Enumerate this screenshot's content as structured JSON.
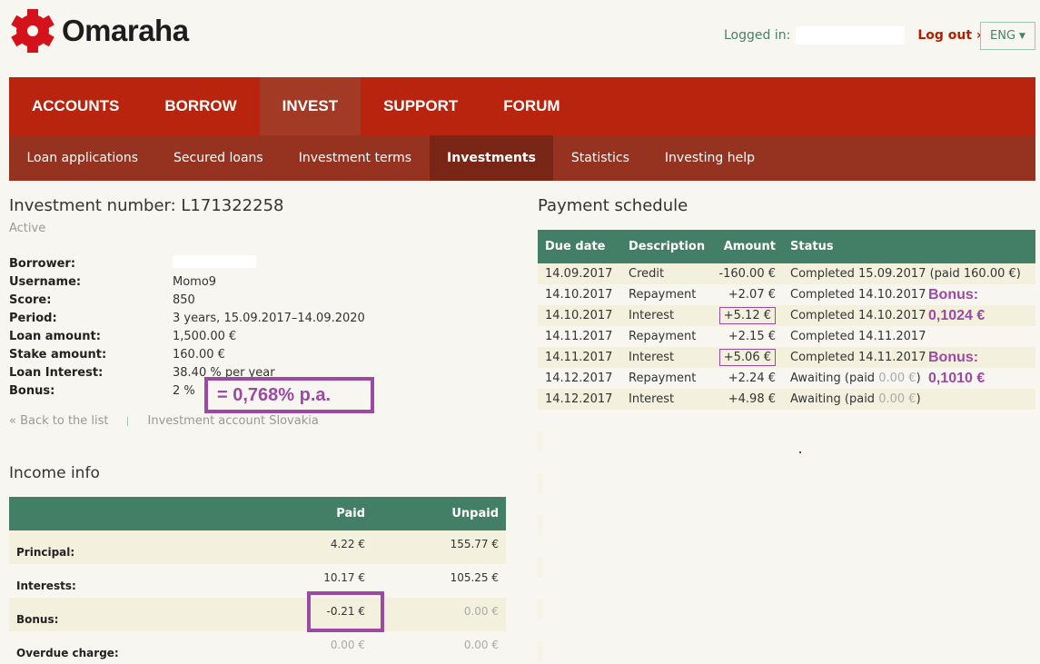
{
  "brand": {
    "name": "Omaraha",
    "logo_color": "#d3121c"
  },
  "header": {
    "logged_in_label": "Logged in:",
    "logout_label": "Log out »",
    "language": "ENG"
  },
  "main_nav": {
    "items": [
      {
        "label": "ACCOUNTS"
      },
      {
        "label": "BORROW"
      },
      {
        "label": "INVEST",
        "active": true
      },
      {
        "label": "SUPPORT"
      },
      {
        "label": "FORUM"
      }
    ]
  },
  "sub_nav": {
    "items": [
      {
        "label": "Loan applications"
      },
      {
        "label": "Secured loans"
      },
      {
        "label": "Investment terms"
      },
      {
        "label": "Investments",
        "active": true
      },
      {
        "label": "Statistics"
      },
      {
        "label": "Investing help"
      }
    ]
  },
  "investment": {
    "title": "Investment number: L171322258",
    "status": "Active",
    "details": [
      {
        "label": "Borrower:",
        "value": ""
      },
      {
        "label": "Username:",
        "value": "Momo9"
      },
      {
        "label": "Score:",
        "value": "850"
      },
      {
        "label": "Period:",
        "value": "3 years, 15.09.2017–14.09.2020"
      },
      {
        "label": "Loan amount:",
        "value": "1,500.00 €"
      },
      {
        "label": "Stake amount:",
        "value": "160.00 €"
      },
      {
        "label": "Loan Interest:",
        "value": "38.40 % per year"
      },
      {
        "label": "Bonus:",
        "value": "2 %"
      }
    ],
    "annotation_pa": "= 0,768% p.a.",
    "back_link": "« Back to the list",
    "account_link": "Investment account Slovakia"
  },
  "income_info": {
    "title": "Income info",
    "headers": [
      "",
      "Paid",
      "Unpaid"
    ],
    "rows": [
      {
        "label": "Principal:",
        "paid": "4.22 €",
        "unpaid": "155.77 €"
      },
      {
        "label": "Interests:",
        "paid": "10.17 €",
        "unpaid": "105.25 €"
      },
      {
        "label": "Bonus:",
        "paid": "-0.21 €",
        "unpaid": "0.00 €"
      },
      {
        "label": "Overdue charge:",
        "paid": "0.00 €",
        "unpaid": "0.00 €"
      }
    ]
  },
  "payment_schedule": {
    "title": "Payment schedule",
    "headers": [
      "Due date",
      "Description",
      "Amount",
      "Status"
    ],
    "rows": [
      {
        "date": "14.09.2017",
        "desc": "Credit",
        "amount": "-160.00 €",
        "status": "Completed 15.09.2017 (paid 160.00 €)"
      },
      {
        "date": "14.10.2017",
        "desc": "Repayment",
        "amount": "+2.07 €",
        "status": "Completed 14.10.2017"
      },
      {
        "date": "14.10.2017",
        "desc": "Interest",
        "amount": "+5.12 €",
        "status": "Completed 14.10.2017"
      },
      {
        "date": "14.11.2017",
        "desc": "Repayment",
        "amount": "+2.15 €",
        "status": "Completed 14.11.2017"
      },
      {
        "date": "14.11.2017",
        "desc": "Interest",
        "amount": "+5.06 €",
        "status": "Completed 14.11.2017"
      },
      {
        "date": "14.12.2017",
        "desc": "Repayment",
        "amount": "+2.24 €",
        "status": "Awaiting (paid ",
        "status_muted": "0.00 €",
        "status_tail": ")"
      },
      {
        "date": "14.12.2017",
        "desc": "Interest",
        "amount": "+4.98 €",
        "status": "Awaiting (paid ",
        "status_muted": "0.00 €",
        "status_tail": ")"
      }
    ],
    "bonus_notes": [
      {
        "label": "Bonus:",
        "value": "0,1024 €"
      },
      {
        "label": "Bonus:",
        "value": "0,1010 €"
      }
    ]
  },
  "colors": {
    "nav_red": "#b8240d",
    "subnav_red": "#963220",
    "table_green": "#437e66",
    "annotation_purple": "#9b4aa3"
  }
}
